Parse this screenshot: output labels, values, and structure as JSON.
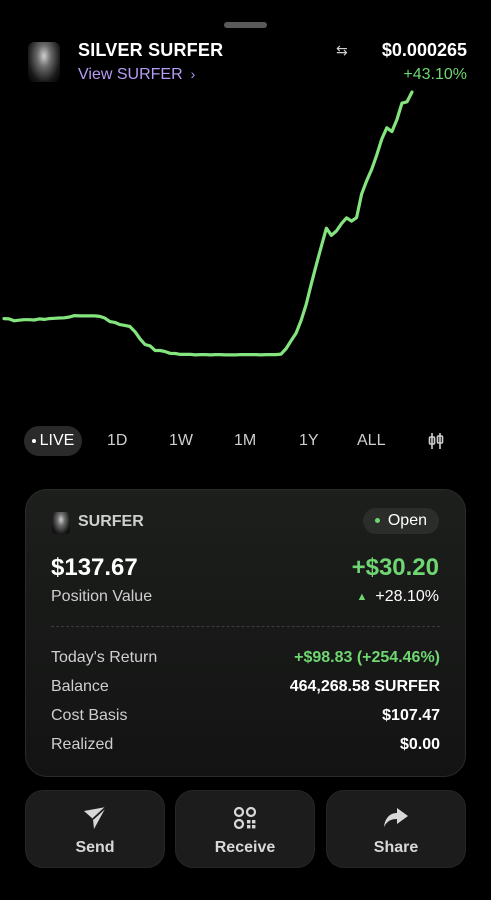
{
  "header": {
    "token_name": "SILVER SURFER",
    "view_link": "View SURFER",
    "swap_icon": "swap-arrows-icon",
    "price": "$0.000265",
    "change_pct": "+43.10%"
  },
  "chart_data": {
    "type": "line",
    "color": "#84e47e",
    "x": [
      0,
      1,
      2,
      3,
      4,
      5,
      6,
      7,
      8,
      9,
      10,
      11,
      12,
      13,
      14,
      15,
      16,
      17,
      18,
      19,
      20,
      21,
      22,
      23,
      24,
      25,
      26,
      27,
      28,
      29,
      30,
      31,
      32,
      33,
      34,
      35,
      36,
      37,
      38,
      39,
      40,
      41,
      42,
      43,
      44,
      45,
      46,
      47,
      48,
      49,
      50,
      51,
      52,
      53,
      54,
      55,
      56,
      57,
      58,
      59,
      60,
      61,
      62,
      63,
      64,
      65,
      66,
      67,
      68,
      69,
      70,
      71,
      72,
      73,
      74,
      75,
      76,
      77,
      78,
      79,
      80,
      81,
      82,
      83,
      84,
      85,
      86,
      87,
      88,
      89,
      90,
      91,
      92,
      93,
      94,
      95,
      96,
      97,
      98,
      99,
      100
    ],
    "values": [
      17.0,
      16.9,
      16.2,
      16.4,
      16.6,
      16.6,
      16.5,
      16.9,
      16.7,
      17.0,
      17.1,
      17.2,
      17.3,
      17.6,
      18.1,
      18.0,
      18.0,
      18.0,
      18.0,
      17.8,
      17.2,
      15.9,
      15.6,
      14.8,
      14.5,
      14.1,
      12.2,
      9.6,
      7.5,
      7.0,
      5.3,
      5.3,
      4.9,
      4.3,
      4.2,
      3.9,
      3.9,
      3.9,
      3.7,
      3.8,
      3.8,
      3.7,
      3.8,
      3.8,
      3.7,
      3.7,
      3.7,
      3.8,
      3.8,
      3.8,
      3.8,
      3.7,
      3.8,
      3.8,
      3.8,
      4.0,
      6.0,
      8.9,
      11.7,
      16.4,
      22.2,
      29.7,
      36.7,
      43.4,
      50.1,
      47.5,
      49.1,
      51.8,
      53.9,
      52.7,
      54.0,
      62.6,
      67.5,
      71.7,
      76.9,
      82.8,
      86.9,
      85.5,
      89.9,
      95.9,
      96.4,
      100.0
    ],
    "xlabel": "",
    "ylabel": ""
  },
  "ranges": {
    "live": "LIVE",
    "items": [
      "1D",
      "1W",
      "1M",
      "1Y",
      "ALL"
    ],
    "icon": "candlestick-toggle-icon"
  },
  "position": {
    "token": "SURFER",
    "status": "Open",
    "value": "$137.67",
    "value_label": "Position Value",
    "pnl": "+$30.20",
    "pnl_pct": "+28.10%",
    "rows": [
      {
        "label": "Today's Return",
        "value": "+$98.83 (+254.46%)"
      },
      {
        "label": "Balance",
        "value": "464,268.58 SURFER"
      },
      {
        "label": "Cost Basis",
        "value": "$107.47"
      },
      {
        "label": "Realized",
        "value": "$0.00"
      }
    ]
  },
  "actions": {
    "send": "Send",
    "receive": "Receive",
    "share": "Share"
  },
  "colors": {
    "accent_green": "#6fd672",
    "link_purple": "#b59cf5",
    "background": "#000000"
  }
}
